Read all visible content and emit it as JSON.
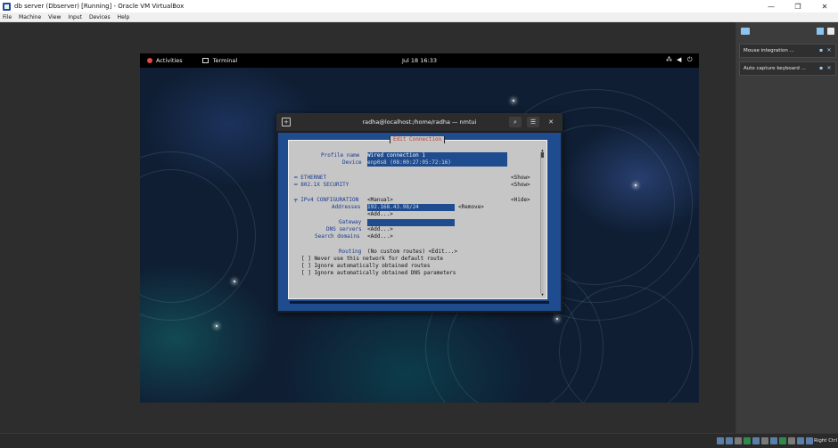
{
  "window": {
    "title": "db server  (Dbserver) [Running] - Oracle VM VirtualBox",
    "minimize": "—",
    "restore": "❐",
    "close": "✕"
  },
  "menu": [
    "File",
    "Machine",
    "View",
    "Input",
    "Devices",
    "Help"
  ],
  "gnome": {
    "activities": "Activities",
    "app": "Terminal",
    "clock": "Jul 18  16:33"
  },
  "terminal": {
    "title": "radha@localhost:/home/radha — nmtui"
  },
  "nmtui": {
    "dialog_title": "Edit Connection",
    "profile_label": "Profile name",
    "profile_value": "Wired connection 1",
    "device_label": "Device",
    "device_value": "enp0s8 (08:00:27:05:72:16)",
    "ethernet": "═ ETHERNET",
    "ethernet_toggle": "<Show>",
    "security": "═ 802.1X SECURITY",
    "security_toggle": "<Show>",
    "ipv4": "╤ IPv4 CONFIGURATION",
    "ipv4_mode": "<Manual>",
    "ipv4_toggle": "<Hide>",
    "addresses_label": "Addresses",
    "address_value": "192.168.43.98/24",
    "remove": "<Remove>",
    "add_address": "<Add...>",
    "gateway_label": "Gateway",
    "gateway_value": "",
    "dns_label": "DNS servers",
    "dns_add": "<Add...>",
    "search_label": "Search domains",
    "search_add": "<Add...>",
    "routing_label": "Routing",
    "routing_value": "(No custom routes) <Edit...>",
    "opt1": "[ ] Never use this network for default route",
    "opt2": "[ ] Ignore automatically obtained routes",
    "opt3": "[ ] Ignore automatically obtained DNS parameters"
  },
  "notifications": [
    {
      "text": "Mouse integration ..."
    },
    {
      "text": "Auto capture keyboard ..."
    }
  ],
  "statusbar": {
    "host_key": "Right Ctrl"
  }
}
